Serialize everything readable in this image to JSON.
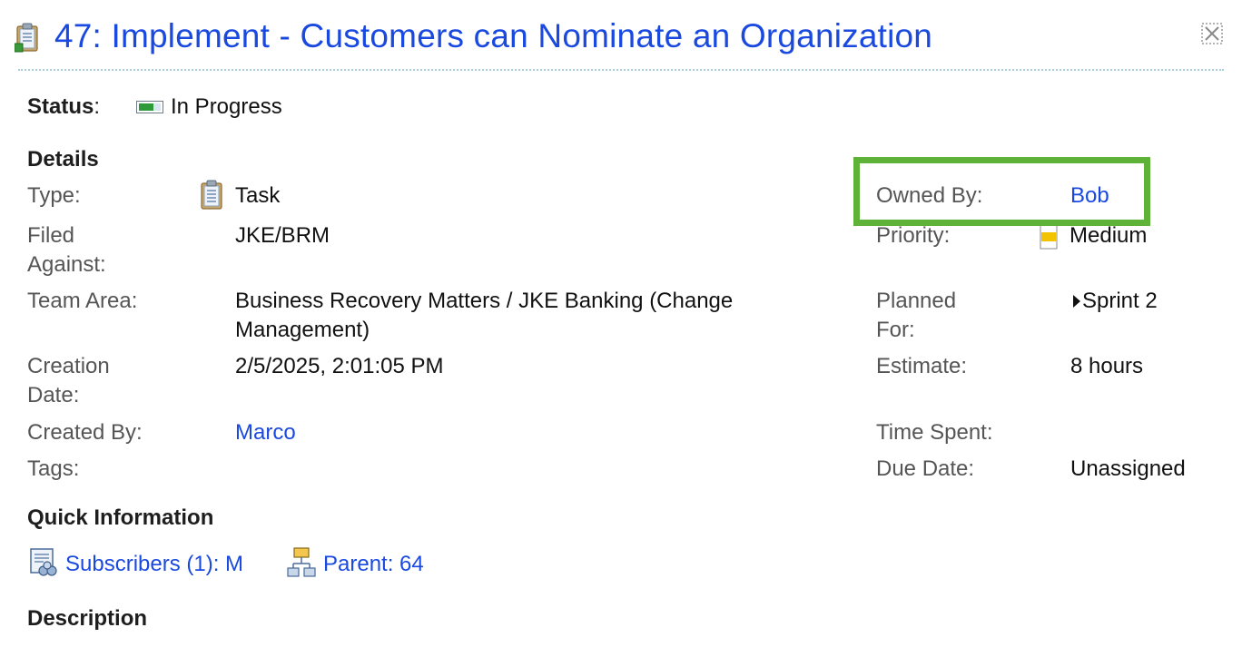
{
  "header": {
    "title": "47: Implement - Customers can Nominate an Organization"
  },
  "status": {
    "label": "Status",
    "colon": ":",
    "value": "In Progress"
  },
  "details": {
    "heading": "Details",
    "type_label": "Type:",
    "type_value": "Task",
    "filed_against_label": "Filed Against:",
    "filed_against_value": "JKE/BRM",
    "team_area_label": "Team Area:",
    "team_area_value": "Business Recovery Matters / JKE Banking (Change Management)",
    "creation_date_label": "Creation Date:",
    "creation_date_value": "2/5/2025, 2:01:05 PM",
    "created_by_label": "Created By:",
    "created_by_value": "Marco",
    "tags_label": "Tags:",
    "owned_by_label": "Owned By:",
    "owned_by_value": "Bob",
    "priority_label": "Priority:",
    "priority_value": "Medium",
    "planned_for_label": "Planned For:",
    "planned_for_value": "Sprint 2",
    "estimate_label": "Estimate:",
    "estimate_value": "8 hours",
    "time_spent_label": "Time Spent:",
    "due_date_label": "Due Date:",
    "due_date_value": "Unassigned"
  },
  "quick_info": {
    "heading": "Quick Information",
    "subscribers_label": "Subscribers (1): M",
    "parent_label": "Parent: 64"
  },
  "description": {
    "heading": "Description"
  },
  "colors": {
    "link": "#1a49e0",
    "highlight": "#5eb237"
  }
}
